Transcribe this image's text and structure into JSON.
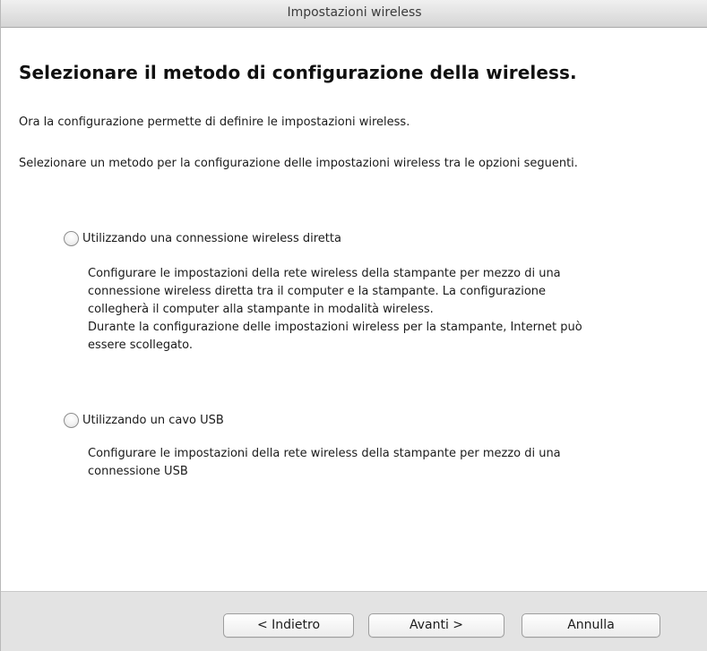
{
  "window": {
    "title": "Impostazioni wireless"
  },
  "content": {
    "heading": "Selezionare il metodo di configurazione della wireless.",
    "intro1": "Ora la configurazione permette di definire le impostazioni wireless.",
    "intro2": "Selezionare un metodo per la configurazione delle impostazioni wireless tra le opzioni seguenti."
  },
  "options": [
    {
      "label": "Utilizzando una connessione wireless diretta",
      "selected": false,
      "description_lines": [
        "Configurare le impostazioni della rete wireless della stampante per mezzo di una",
        "connessione wireless diretta tra il computer e la stampante. La configurazione",
        "collegherà il computer alla stampante in modalità wireless.",
        "Durante la configurazione delle impostazioni wireless per la stampante, Internet può",
        "essere scollegato."
      ]
    },
    {
      "label": "Utilizzando un cavo USB",
      "selected": false,
      "description_lines": [
        "Configurare le impostazioni della rete wireless della stampante per mezzo di una",
        "connessione USB"
      ]
    }
  ],
  "buttons": {
    "back": "< Indietro",
    "next": "Avanti >",
    "cancel": "Annulla"
  }
}
